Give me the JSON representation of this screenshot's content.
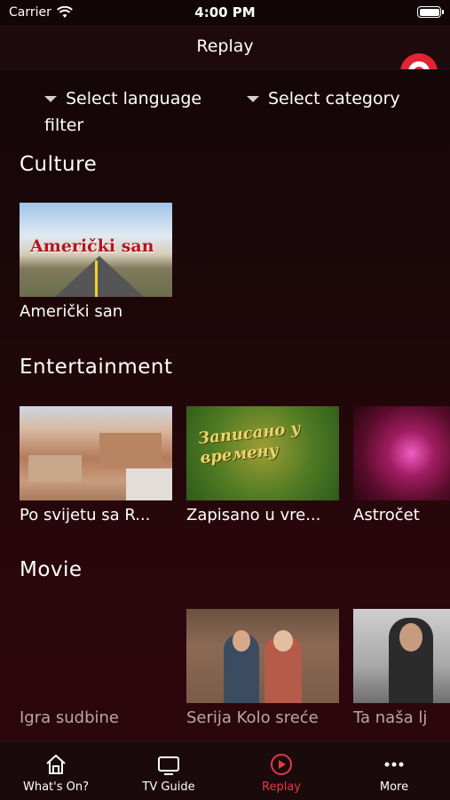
{
  "status_bar": {
    "carrier": "Carrier",
    "time": "4:00 PM"
  },
  "header": {
    "title": "Replay"
  },
  "filters": {
    "language_line1": "Select language",
    "language_line2": "filter",
    "category": "Select category"
  },
  "sections": [
    {
      "title": "Culture",
      "items": [
        {
          "title": "Američki san",
          "overlay": "Američki san"
        }
      ]
    },
    {
      "title": "Entertainment",
      "items": [
        {
          "title": "Po svijetu sa R..."
        },
        {
          "title": "Zapisano u vre...",
          "overlay": "Записано у времену"
        },
        {
          "title": "Astročet"
        }
      ]
    },
    {
      "title": "Movie",
      "items": [
        {
          "title": "Igra sudbine"
        },
        {
          "title": "Serija Kolo sreće"
        },
        {
          "title": "Ta naša lj"
        }
      ]
    }
  ],
  "tabs": [
    {
      "label": "What's On?",
      "icon": "home-icon"
    },
    {
      "label": "TV Guide",
      "icon": "tv-icon"
    },
    {
      "label": "Replay",
      "icon": "replay-icon",
      "active": true
    },
    {
      "label": "More",
      "icon": "more-icon"
    }
  ],
  "colors": {
    "accent": "#e53946",
    "background": "#1c0709",
    "tab_bar": "#1b0a0c"
  }
}
